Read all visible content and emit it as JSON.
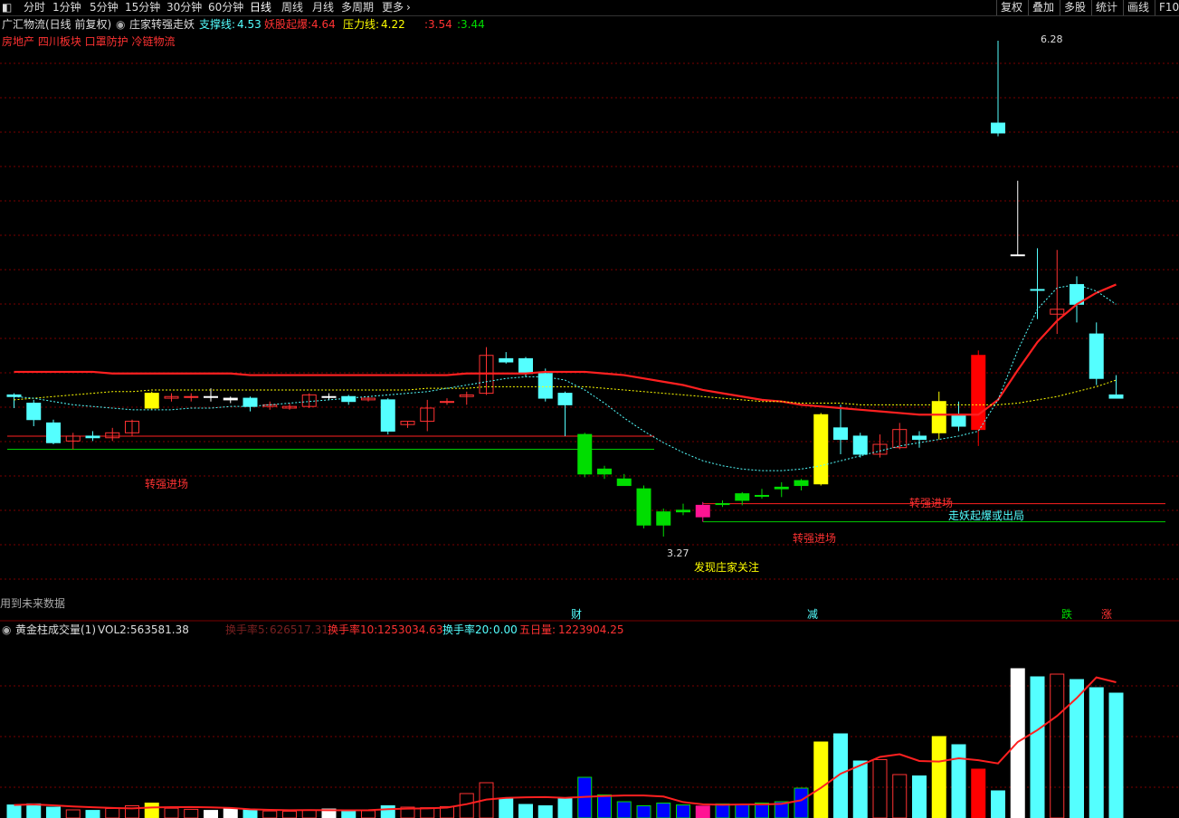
{
  "toolbar": {
    "periods": [
      "分时",
      "1分钟",
      "5分钟",
      "15分钟",
      "30分钟",
      "60分钟",
      "日线",
      "周线",
      "月线",
      "多周期",
      "更多"
    ],
    "active_period": "日线",
    "right_buttons": [
      "复权",
      "叠加",
      "多股",
      "统计",
      "画线",
      "F10"
    ]
  },
  "main_header": {
    "title": "广汇物流(日线 前复权)",
    "indicator_name": "庄家转强走妖",
    "support_label": "支撑线:",
    "support_value": "4.53",
    "yao_label": "妖股起爆:",
    "yao_value": "4.64",
    "pressure_label": "压力线:",
    "pressure_value": "4.22",
    "extra1": ":3.54",
    "extra2": ":3.44",
    "sectors": "房地产 四川板块 口罩防护 冷链物流"
  },
  "annotations": {
    "enter1": "转强进场",
    "enter2": "转强进场",
    "enter3": "转强进场",
    "exit": "走妖起爆或出局",
    "notice": "发现庄家关注",
    "low_price": "3.27",
    "high_price": "6.28",
    "future_data": "用到未来数据",
    "cai": "财",
    "jian": "减",
    "die": "跌",
    "zhang": "涨"
  },
  "vol_header": {
    "name": "黄金柱成交量(1)",
    "vol2_label": "VOL2:",
    "vol2_value": "563581.38",
    "hs5_label": "换手率5:",
    "hs5_value": "626517.31",
    "hs10_label": "换手率10:",
    "hs10_value": "1253034.63",
    "hs20_label": "换手率20:",
    "hs20_value": "0.00",
    "wuri_label": "五日量:",
    "wuri_value": "1223904.25"
  },
  "colors": {
    "up": "#ff3232",
    "down": "#54ffff",
    "limit_up": "#ffff00",
    "red_strong": "#ff0000",
    "green": "#00dd00",
    "pink": "#ff1493",
    "grid": "#7a0000",
    "volume_blue": "#0000ff"
  },
  "chart_data": {
    "type": "candlestick",
    "price_range": [
      3.0,
      6.5
    ],
    "candles": [
      {
        "o": 4.12,
        "h": 4.14,
        "l": 4.05,
        "c": 4.13,
        "color": "down"
      },
      {
        "o": 4.08,
        "h": 4.1,
        "l": 3.94,
        "c": 3.98,
        "color": "down"
      },
      {
        "o": 3.96,
        "h": 3.98,
        "l": 3.83,
        "c": 3.84,
        "color": "down"
      },
      {
        "o": 3.85,
        "h": 3.9,
        "l": 3.8,
        "c": 3.88,
        "color": "up"
      },
      {
        "o": 3.88,
        "h": 3.91,
        "l": 3.85,
        "c": 3.87,
        "color": "down"
      },
      {
        "o": 3.87,
        "h": 3.93,
        "l": 3.85,
        "c": 3.9,
        "color": "up"
      },
      {
        "o": 3.9,
        "h": 3.98,
        "l": 3.88,
        "c": 3.97,
        "color": "up"
      },
      {
        "o": 4.05,
        "h": 4.15,
        "l": 4.04,
        "c": 4.14,
        "color": "limit_up"
      },
      {
        "o": 4.12,
        "h": 4.14,
        "l": 4.09,
        "c": 4.11,
        "color": "up"
      },
      {
        "o": 4.12,
        "h": 4.14,
        "l": 4.09,
        "c": 4.12,
        "color": "up"
      },
      {
        "o": 4.12,
        "h": 4.17,
        "l": 4.09,
        "c": 4.12,
        "color": "white"
      },
      {
        "o": 4.11,
        "h": 4.12,
        "l": 4.08,
        "c": 4.1,
        "color": "white"
      },
      {
        "o": 4.11,
        "h": 4.12,
        "l": 4.03,
        "c": 4.06,
        "color": "down"
      },
      {
        "o": 4.07,
        "h": 4.09,
        "l": 4.04,
        "c": 4.06,
        "color": "up"
      },
      {
        "o": 4.06,
        "h": 4.08,
        "l": 4.04,
        "c": 4.05,
        "color": "up"
      },
      {
        "o": 4.06,
        "h": 4.14,
        "l": 4.05,
        "c": 4.13,
        "color": "up"
      },
      {
        "o": 4.12,
        "h": 4.14,
        "l": 4.1,
        "c": 4.12,
        "color": "white"
      },
      {
        "o": 4.12,
        "h": 4.13,
        "l": 4.07,
        "c": 4.09,
        "color": "down"
      },
      {
        "o": 4.11,
        "h": 4.12,
        "l": 4.09,
        "c": 4.1,
        "color": "up"
      },
      {
        "o": 4.1,
        "h": 4.11,
        "l": 3.89,
        "c": 3.91,
        "color": "down"
      },
      {
        "o": 3.95,
        "h": 3.97,
        "l": 3.93,
        "c": 3.97,
        "color": "up"
      },
      {
        "o": 3.97,
        "h": 4.1,
        "l": 3.91,
        "c": 4.05,
        "color": "up"
      },
      {
        "o": 4.09,
        "h": 4.11,
        "l": 4.07,
        "c": 4.09,
        "color": "up"
      },
      {
        "o": 4.13,
        "h": 4.15,
        "l": 4.07,
        "c": 4.12,
        "color": "up"
      },
      {
        "o": 4.14,
        "h": 4.42,
        "l": 4.13,
        "c": 4.37,
        "color": "up"
      },
      {
        "o": 4.35,
        "h": 4.39,
        "l": 4.32,
        "c": 4.33,
        "color": "down"
      },
      {
        "o": 4.35,
        "h": 4.36,
        "l": 4.24,
        "c": 4.26,
        "color": "down"
      },
      {
        "o": 4.26,
        "h": 4.29,
        "l": 4.09,
        "c": 4.11,
        "color": "down"
      },
      {
        "o": 4.14,
        "h": 4.15,
        "l": 3.88,
        "c": 4.07,
        "color": "down"
      },
      {
        "o": 3.89,
        "h": 3.9,
        "l": 3.63,
        "c": 3.65,
        "color": "green"
      },
      {
        "o": 3.68,
        "h": 3.7,
        "l": 3.62,
        "c": 3.65,
        "color": "green"
      },
      {
        "o": 3.62,
        "h": 3.65,
        "l": 3.58,
        "c": 3.58,
        "color": "green"
      },
      {
        "o": 3.56,
        "h": 3.58,
        "l": 3.32,
        "c": 3.34,
        "color": "green"
      },
      {
        "o": 3.34,
        "h": 3.44,
        "l": 3.27,
        "c": 3.42,
        "color": "green"
      },
      {
        "o": 3.42,
        "h": 3.47,
        "l": 3.4,
        "c": 3.43,
        "color": "green"
      },
      {
        "o": 3.39,
        "h": 3.48,
        "l": 3.36,
        "c": 3.46,
        "color": "pink"
      },
      {
        "o": 3.47,
        "h": 3.49,
        "l": 3.45,
        "c": 3.47,
        "color": "green"
      },
      {
        "o": 3.49,
        "h": 3.54,
        "l": 3.46,
        "c": 3.53,
        "color": "green"
      },
      {
        "o": 3.52,
        "h": 3.56,
        "l": 3.5,
        "c": 3.52,
        "color": "green"
      },
      {
        "o": 3.56,
        "h": 3.6,
        "l": 3.51,
        "c": 3.57,
        "color": "green"
      },
      {
        "o": 3.58,
        "h": 3.62,
        "l": 3.55,
        "c": 3.61,
        "color": "green"
      },
      {
        "o": 3.59,
        "h": 4.02,
        "l": 3.58,
        "c": 4.01,
        "color": "limit_up"
      },
      {
        "o": 3.93,
        "h": 4.07,
        "l": 3.77,
        "c": 3.86,
        "color": "down"
      },
      {
        "o": 3.88,
        "h": 3.9,
        "l": 3.75,
        "c": 3.77,
        "color": "down"
      },
      {
        "o": 3.77,
        "h": 3.89,
        "l": 3.75,
        "c": 3.83,
        "color": "up"
      },
      {
        "o": 3.81,
        "h": 3.96,
        "l": 3.8,
        "c": 3.92,
        "color": "up"
      },
      {
        "o": 3.88,
        "h": 3.91,
        "l": 3.81,
        "c": 3.86,
        "color": "down"
      },
      {
        "o": 3.9,
        "h": 4.15,
        "l": 3.86,
        "c": 4.09,
        "color": "limit_up"
      },
      {
        "o": 4.01,
        "h": 4.09,
        "l": 3.91,
        "c": 3.94,
        "color": "down"
      },
      {
        "o": 3.92,
        "h": 4.4,
        "l": 3.82,
        "c": 4.37,
        "color": "red_strong"
      },
      {
        "o": 5.78,
        "h": 6.28,
        "l": 5.7,
        "c": 5.72,
        "color": "down"
      },
      {
        "o": 4.98,
        "h": 5.43,
        "l": 4.98,
        "c": 4.98,
        "color": "white"
      },
      {
        "o": 4.77,
        "h": 5.02,
        "l": 4.59,
        "c": 4.77,
        "color": "down"
      },
      {
        "o": 4.65,
        "h": 5.01,
        "l": 4.5,
        "c": 4.62,
        "color": "up"
      },
      {
        "o": 4.8,
        "h": 4.85,
        "l": 4.57,
        "c": 4.68,
        "color": "down"
      },
      {
        "o": 4.5,
        "h": 4.57,
        "l": 4.19,
        "c": 4.23,
        "color": "down"
      },
      {
        "o": 4.13,
        "h": 4.25,
        "l": 4.11,
        "c": 4.11,
        "color": "down"
      }
    ],
    "volume": [
      48,
      52,
      40,
      30,
      28,
      35,
      45,
      55,
      36,
      32,
      28,
      34,
      30,
      26,
      25,
      30,
      33,
      28,
      27,
      45,
      40,
      38,
      42,
      90,
      130,
      70,
      50,
      45,
      75,
      150,
      85,
      60,
      45,
      55,
      48,
      44,
      52,
      50,
      55,
      60,
      110,
      280,
      310,
      210,
      215,
      160,
      155,
      300,
      270,
      180,
      100,
      550,
      520,
      530,
      510,
      480,
      460
    ]
  }
}
